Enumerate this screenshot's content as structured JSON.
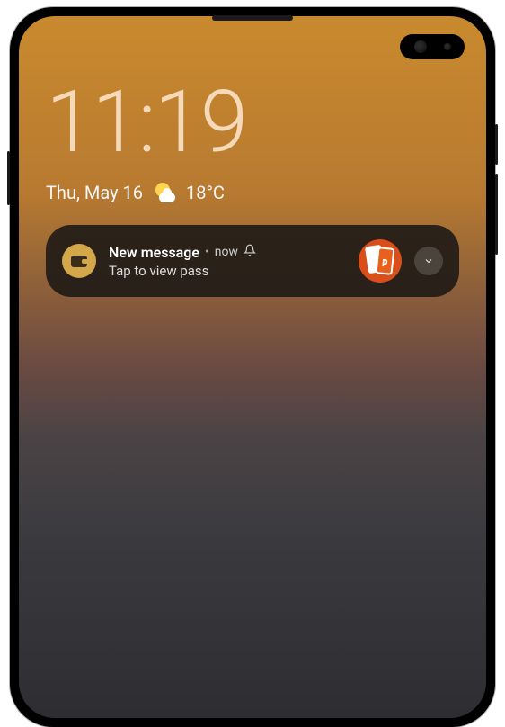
{
  "lockscreen": {
    "time": "11:19",
    "date": "Thu, May 16",
    "temp": "18°C"
  },
  "notification": {
    "title": "New message",
    "separator": "•",
    "time": "now",
    "body": "Tap to view pass",
    "thumb_letter": "p"
  }
}
